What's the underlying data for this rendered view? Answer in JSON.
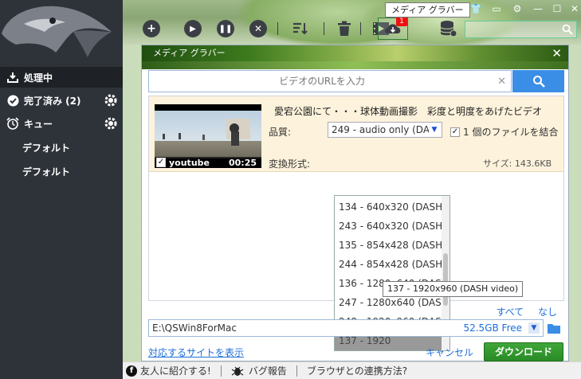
{
  "sidebar": {
    "items": [
      {
        "label": "処理中",
        "icon": "download-tray-icon"
      },
      {
        "label": "完了済み (2)",
        "icon": "check-circle-icon"
      },
      {
        "label": "キュー",
        "icon": "alarm-clock-icon"
      },
      {
        "label": "デフォルト"
      },
      {
        "label": "デフォルト"
      }
    ]
  },
  "toolbar": {
    "tooltip": "メディア グラバー",
    "badge": "1",
    "icons": [
      "add-icon",
      "play-icon",
      "pause-icon",
      "stop-icon",
      "sort-icon",
      "trash-icon",
      "video-film-icon",
      "cloud-download-icon",
      "database-icon"
    ]
  },
  "dialog": {
    "title": "メディア グラバー",
    "url_placeholder": "ビデオのURLを入力",
    "item": {
      "title": "愛宕公園にて・・・球体動画撮影　彩度と明度をあげたビデオ",
      "source": "youtube",
      "duration": "00:25",
      "quality_label": "品質:",
      "quality_value": "249 - audio only (DA",
      "combine_label": "1 個のファイルを結合",
      "convert_label": "変換形式:",
      "size_label": "サイズ: 143.6KB"
    },
    "dropdown_items": [
      "134 - 640x320 (DASH ...",
      "243 - 640x320 (DASH ...",
      "135 - 854x428 (DASH ...",
      "244 - 854x428 (DASH ...",
      "136 - 1280x640 (DAS...",
      "247 - 1280x640 (DAS...",
      "248 - 1920x960 (DAS...",
      "137 - 1920"
    ],
    "dropdown_tooltip": "137 - 1920x960 (DASH video)",
    "select_all": "すべて",
    "select_none": "なし",
    "path": "E:\\QSWin8ForMac",
    "free_space": "52.5GB Free",
    "sites_link": "対応するサイトを表示",
    "cancel": "キャンセル",
    "download": "ダウンロード"
  },
  "statusbar": {
    "share": "友人に紹介する!",
    "bug": "バグ報告",
    "browser": "ブラウザとの連携方法?"
  },
  "colors": {
    "sidebar_bg": "#2e333a",
    "accent_blue": "#3a8ee6",
    "download_green": "#2a8b26",
    "item_bg": "#fdf2db"
  }
}
